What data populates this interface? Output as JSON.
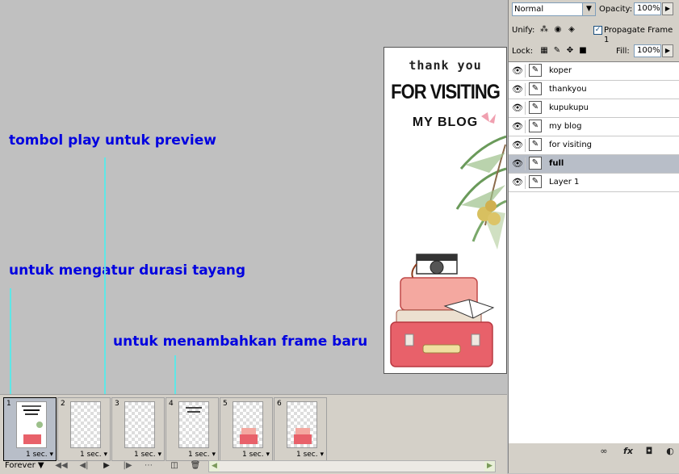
{
  "annotations": {
    "play": "tombol play untuk preview",
    "duration": "untuk mengatur durasi tayang",
    "new_frame": "untuk menambahkan frame baru"
  },
  "document": {
    "line1": "thank you",
    "line2": "FOR VISITING",
    "line3": "MY BLOG"
  },
  "layers_panel": {
    "blend_mode": "Normal",
    "opacity_label": "Opacity:",
    "opacity_value": "100%",
    "unify_label": "Unify:",
    "propagate_label": "Propagate Frame 1",
    "propagate_checked": true,
    "lock_label": "Lock:",
    "fill_label": "Fill:",
    "fill_value": "100%",
    "layers": [
      {
        "name": "koper",
        "visible": true,
        "selected": false
      },
      {
        "name": "thankyou",
        "visible": true,
        "selected": false
      },
      {
        "name": "kupukupu",
        "visible": true,
        "selected": false
      },
      {
        "name": "my blog",
        "visible": true,
        "selected": false
      },
      {
        "name": "for visiting",
        "visible": true,
        "selected": false
      },
      {
        "name": "full",
        "visible": true,
        "selected": true
      },
      {
        "name": "Layer 1",
        "visible": true,
        "selected": false
      }
    ]
  },
  "animation": {
    "loop": "Forever",
    "frames": [
      {
        "number": "1",
        "duration": "1 sec.",
        "active": true,
        "thumb": "full"
      },
      {
        "number": "2",
        "duration": "1 sec.",
        "active": false,
        "thumb": "transparent"
      },
      {
        "number": "3",
        "duration": "1 sec.",
        "active": false,
        "thumb": "transparent"
      },
      {
        "number": "4",
        "duration": "1 sec.",
        "active": false,
        "thumb": "text"
      },
      {
        "number": "5",
        "duration": "1 sec.",
        "active": false,
        "thumb": "suitcase"
      },
      {
        "number": "6",
        "duration": "1 sec.",
        "active": false,
        "thumb": "suitcase"
      }
    ]
  },
  "colors": {
    "annotation_text": "#0000e0",
    "annotation_line": "#5fe6e6",
    "selected_layer": "#b8bec8",
    "suitcase": "#e8616a"
  }
}
